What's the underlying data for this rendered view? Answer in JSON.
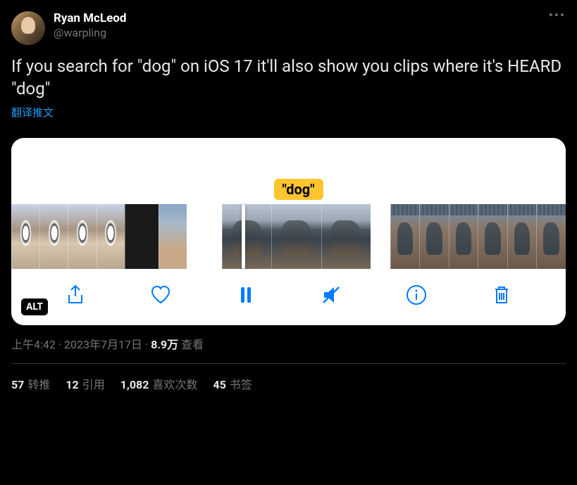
{
  "author": {
    "display_name": "Ryan McLeod",
    "handle": "@warpling"
  },
  "tweet_text": "If you search for \"dog\" on iOS 17 it'll also show you clips where it's HEARD \"dog\"",
  "translate_label": "翻译推文",
  "media": {
    "highlight_label": "\"dog\"",
    "alt_badge": "ALT"
  },
  "meta": {
    "time": "上午4:42",
    "date": "2023年7月17日",
    "views_count": "8.9万",
    "views_label": "查看"
  },
  "stats": {
    "retweets_count": "57",
    "retweets_label": "转推",
    "quotes_count": "12",
    "quotes_label": "引用",
    "likes_count": "1,082",
    "likes_label": "喜欢次数",
    "bookmarks_count": "45",
    "bookmarks_label": "书签"
  }
}
